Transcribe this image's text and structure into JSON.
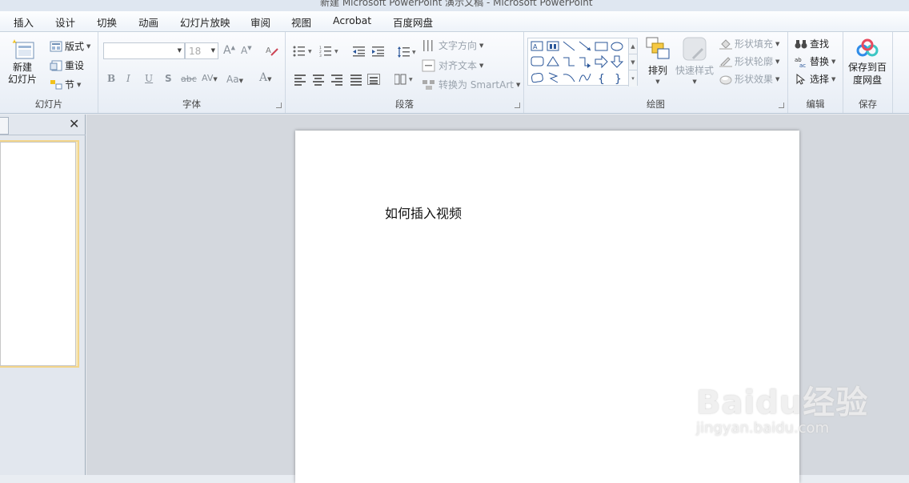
{
  "window": {
    "title": "新建 Microsoft PowerPoint 演示文稿 - Microsoft PowerPoint"
  },
  "menu": [
    "插入",
    "设计",
    "切换",
    "动画",
    "幻灯片放映",
    "审阅",
    "视图",
    "Acrobat",
    "百度网盘"
  ],
  "ribbon": {
    "slides": {
      "label": "幻灯片",
      "new_slide": "新建\n幻灯片",
      "layout": "版式",
      "reset": "重设",
      "section": "节"
    },
    "font": {
      "label": "字体",
      "font_name": "",
      "font_size": "18",
      "bold": "B",
      "italic": "I",
      "underline": "U",
      "shadow": "S",
      "strike": "abc",
      "spacing": "AV",
      "case": "Aa",
      "color": "A",
      "grow": "A",
      "shrink": "A"
    },
    "paragraph": {
      "label": "段落",
      "text_direction": "文字方向",
      "align_text": "对齐文本",
      "convert_smartart": "转换为 SmartArt"
    },
    "drawing": {
      "label": "绘图",
      "arrange": "排列",
      "quick_styles": "快速样式",
      "shape_fill": "形状填充",
      "shape_outline": "形状轮廓",
      "shape_effects": "形状效果"
    },
    "editing": {
      "label": "编辑",
      "find": "查找",
      "replace": "替换",
      "select": "选择"
    },
    "save": {
      "label": "保存",
      "save_baidu": "保存到百\n度网盘"
    }
  },
  "slide": {
    "text": "如何插入视频"
  },
  "watermark": {
    "brand": "Baidu经验",
    "url": "jingyan.baidu.com"
  },
  "colors": {
    "accent": "#2b579a",
    "ribbon_bg": "#e7edf5",
    "selected_thumb": "#f3d58a"
  }
}
